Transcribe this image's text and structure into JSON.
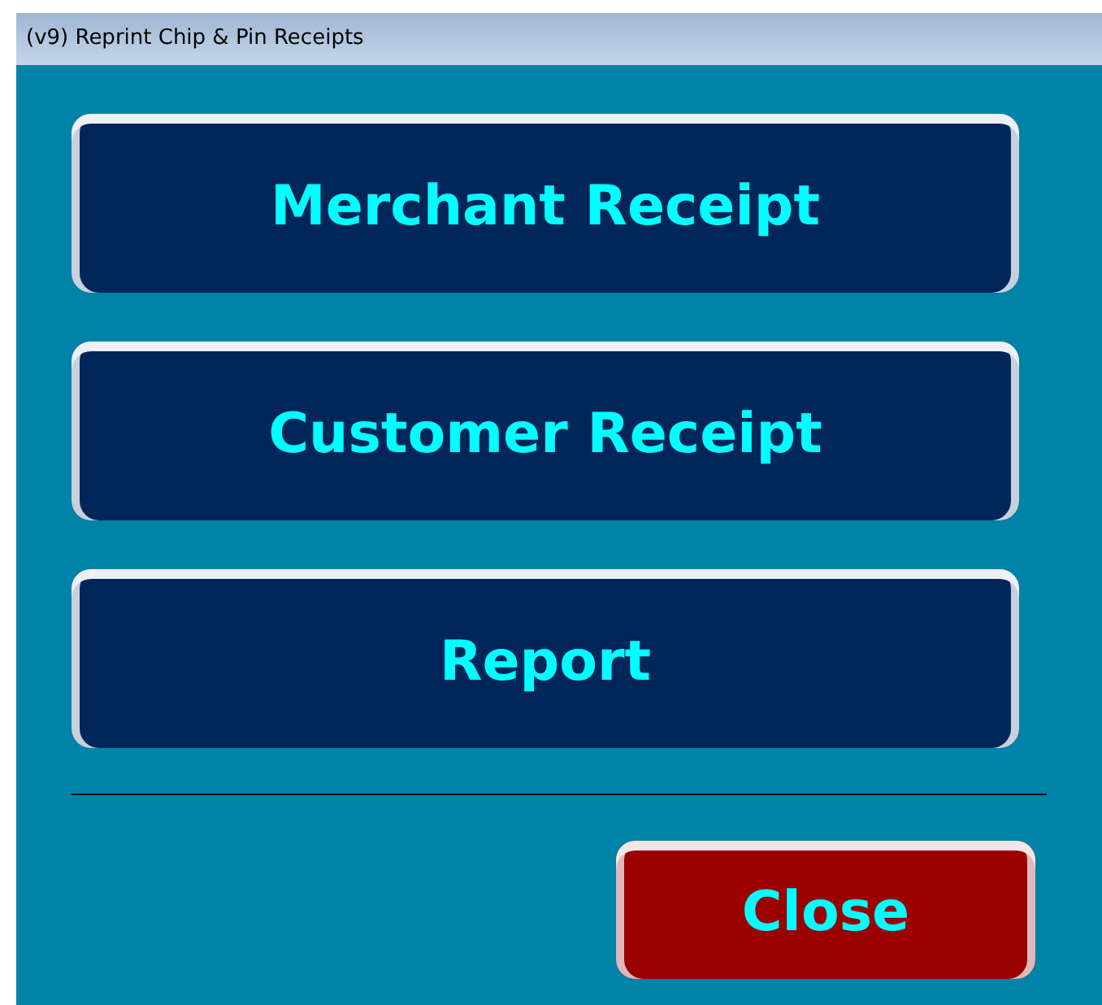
{
  "window": {
    "title": "(v9) Reprint Chip & Pin Receipts"
  },
  "buttons": [
    {
      "label": "Merchant Receipt",
      "kind": "primary"
    },
    {
      "label": "Customer Receipt",
      "kind": "primary"
    },
    {
      "label": "Report",
      "kind": "primary"
    }
  ],
  "footer_buttons": [
    {
      "label": "Close",
      "kind": "danger"
    }
  ]
}
